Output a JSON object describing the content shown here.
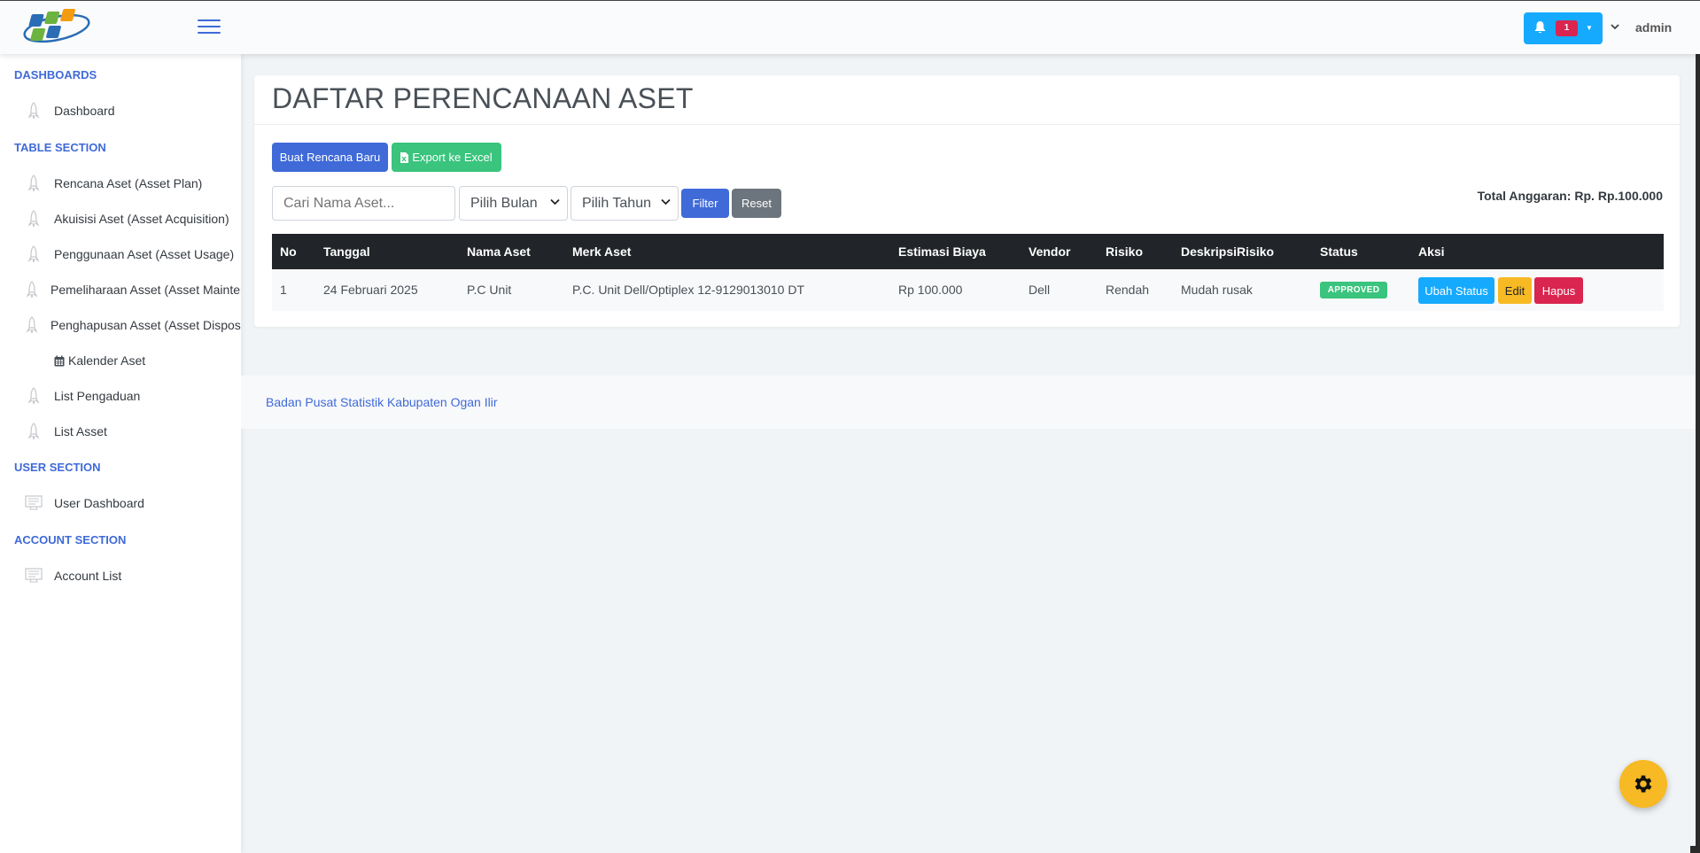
{
  "header": {
    "notification_count": "1",
    "user_name": "admin"
  },
  "sidebar": {
    "sections": [
      {
        "title": "DASHBOARDS"
      },
      {
        "title": "TABLE SECTION"
      },
      {
        "title": "USER SECTION"
      },
      {
        "title": "ACCOUNT SECTION"
      }
    ],
    "items": [
      {
        "label": "Dashboard",
        "icon": "rocket-icon"
      },
      {
        "label": "Rencana Aset (Asset Plan)",
        "icon": "rocket-icon"
      },
      {
        "label": "Akuisisi Aset (Asset Acquisition)",
        "icon": "rocket-icon"
      },
      {
        "label": "Penggunaan Aset (Asset Usage)",
        "icon": "rocket-icon"
      },
      {
        "label": "Pemeliharaan Asset (Asset Maintenance)",
        "icon": "rocket-icon"
      },
      {
        "label": "Penghapusan Asset (Asset Disposal)",
        "icon": "rocket-icon"
      },
      {
        "label": "Kalender Aset",
        "icon": "calendar-icon"
      },
      {
        "label": "List Pengaduan",
        "icon": "rocket-icon"
      },
      {
        "label": "List Asset",
        "icon": "rocket-icon"
      },
      {
        "label": "User Dashboard",
        "icon": "monitor-icon"
      },
      {
        "label": "Account List",
        "icon": "monitor-icon"
      }
    ]
  },
  "main": {
    "title": "DAFTAR PERENCANAAN ASET",
    "create_button": "Buat Rencana Baru",
    "export_button": "Export ke Excel",
    "search_placeholder": "Cari Nama Aset...",
    "month_select": "Pilih Bulan",
    "year_select": "Pilih Tahun",
    "filter_button": "Filter",
    "reset_button": "Reset",
    "total_label": "Total Anggaran:",
    "total_value": "Rp. Rp.100.000",
    "table": {
      "headers": [
        "No",
        "Tanggal",
        "Nama Aset",
        "Merk Aset",
        "Estimasi Biaya",
        "Vendor",
        "Risiko",
        "DeskripsiRisiko",
        "Status",
        "Aksi"
      ],
      "rows": [
        {
          "no": "1",
          "tanggal": "24 Februari 2025",
          "nama": "P.C Unit",
          "merk": "P.C. Unit Dell/Optiplex 12-9129013010 DT",
          "biaya": "Rp 100.000",
          "vendor": "Dell",
          "risiko": "Rendah",
          "deskripsi": "Mudah rusak",
          "status": "APPROVED",
          "actions": {
            "status": "Ubah Status",
            "edit": "Edit",
            "delete": "Hapus"
          }
        }
      ]
    }
  },
  "footer": {
    "text": "Badan Pusat Statistik Kabupaten Ogan Ilir"
  },
  "colors": {
    "primary": "#3f6ad8",
    "success": "#3ac47d",
    "info": "#16aaff",
    "warning": "#f7b924",
    "danger": "#d92550",
    "secondary": "#6c757d",
    "table_header": "#212529"
  }
}
